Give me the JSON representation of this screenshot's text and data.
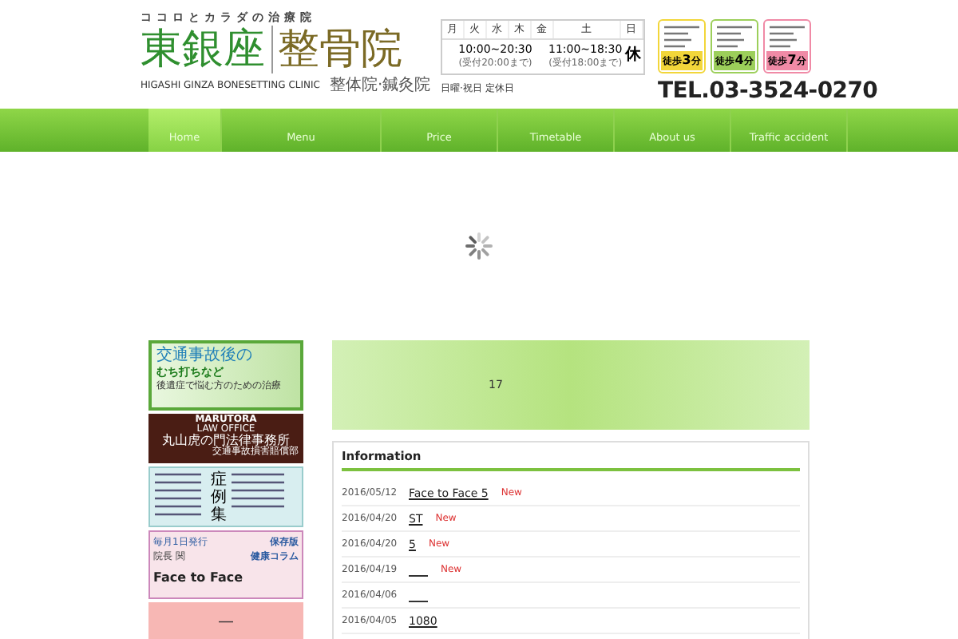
{
  "logo": {
    "tagline": "ココロとカラダの治療院",
    "name": "東銀座",
    "type": "整骨院",
    "romaji": "HIGASHI GINZA BONESETTING CLINIC",
    "sub": "整体院·鍼灸院"
  },
  "schedule": {
    "days": [
      {
        "label": "月"
      },
      {
        "label": "火"
      },
      {
        "label": "水"
      },
      {
        "label": "木"
      },
      {
        "label": "金"
      },
      {
        "label": "土"
      },
      {
        "label": "日"
      }
    ],
    "weekday_hours": "10:00~20:30",
    "weekday_note": "(受付20:00まで)",
    "saturday_hours": "11:00~18:30",
    "saturday_note": "(受付18:00まで)",
    "sunday": "休",
    "note": "日曜·祝日 定休日"
  },
  "stations": [
    {
      "walk": "徒歩",
      "minutes": "3",
      "unit": "分",
      "color": "#f2d63a"
    },
    {
      "walk": "徒歩",
      "minutes": "4",
      "unit": "分",
      "color": "#9ccf5a"
    },
    {
      "walk": "徒歩",
      "minutes": "7",
      "unit": "分",
      "color": "#f08aa6"
    }
  ],
  "phone": "TEL.03-3524-0270",
  "nav": [
    {
      "label": "Home",
      "selected": true
    },
    {
      "label": "Menu",
      "selected": false
    },
    {
      "label": "Price",
      "selected": false
    },
    {
      "label": "Timetable",
      "selected": false
    },
    {
      "label": "About us",
      "selected": false
    },
    {
      "label": "Traffic accident",
      "selected": false
    }
  ],
  "banners": [
    {
      "kind": "accident",
      "lines": [
        "交通事故後の",
        "むち打ちなど",
        "後遺症で悩む方のための治療"
      ]
    },
    {
      "kind": "law",
      "lines": [
        "MARUTORA",
        "LAW OFFICE",
        "丸山虎の門法律事務所",
        "交通事故損害賠償部"
      ]
    },
    {
      "kind": "cases",
      "title": "症例集"
    },
    {
      "kind": "column",
      "lines": [
        "毎月1日発行",
        "院長 関",
        "Face to Face",
        "保存版",
        "健康コラム"
      ]
    },
    {
      "kind": "plain",
      "lines": [
        "—"
      ]
    }
  ],
  "slider": {
    "text": "17"
  },
  "information": {
    "title": "Information",
    "items": [
      {
        "date": "2016/05/12",
        "title": "Face to Face 5",
        "badge": "New"
      },
      {
        "date": "2016/04/20",
        "title": "ST",
        "badge": "New"
      },
      {
        "date": "2016/04/20",
        "title": "5",
        "badge": "New"
      },
      {
        "date": "2016/04/19",
        "badge": "New"
      },
      {
        "date": "2016/04/06"
      },
      {
        "date": "2016/04/05",
        "title": "1080"
      }
    ]
  }
}
